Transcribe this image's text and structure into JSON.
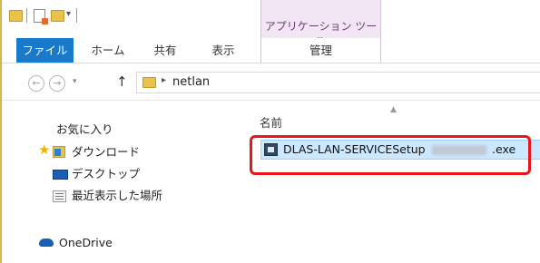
{
  "ribbon": {
    "context_title": "アプリケーション ツール",
    "tabs": {
      "file": "ファイル",
      "home": "ホーム",
      "share": "共有",
      "view": "表示",
      "manage": "管理"
    }
  },
  "address": {
    "path": "netlan"
  },
  "nav": {
    "favorites": "お気に入り",
    "downloads": "ダウンロード",
    "desktop": "デスクトップ",
    "recent": "最近表示した場所",
    "onedrive": "OneDrive"
  },
  "content": {
    "column_name": "名前",
    "file": {
      "name_prefix": "DLAS-LAN-SERVICESetup",
      "extension": ".exe"
    }
  },
  "colors": {
    "file_tab": "#1979ca",
    "context_tab": "#f3e6f4",
    "selection": "#cce8ff",
    "highlight": "#e8161b"
  }
}
